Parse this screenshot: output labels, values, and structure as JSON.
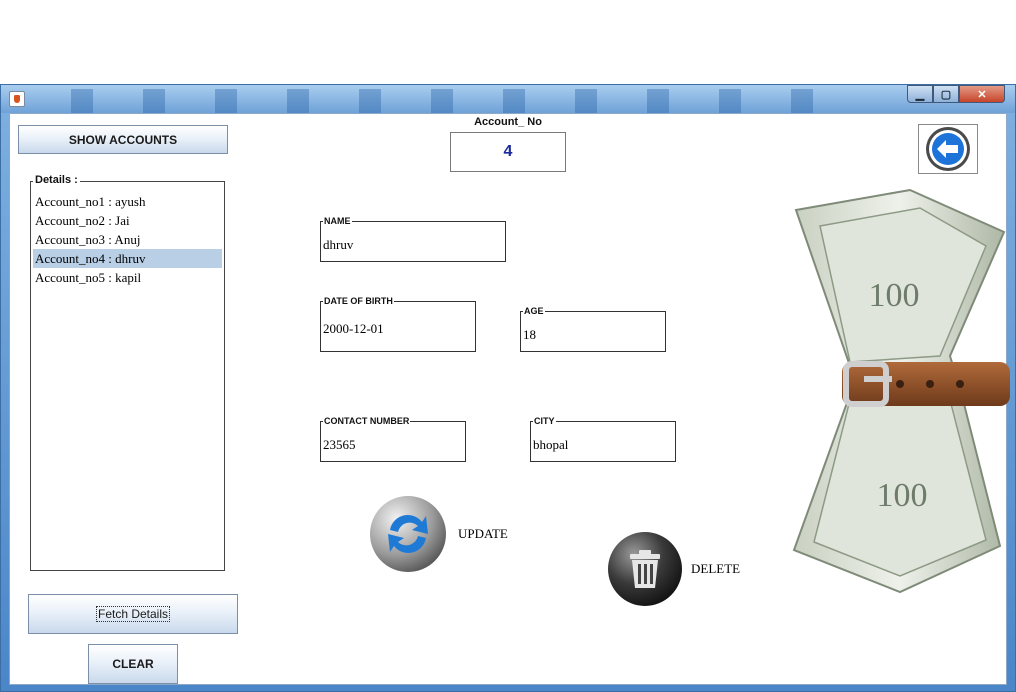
{
  "window": {
    "controls": {
      "minimize_icon": "minimize-icon",
      "maximize_icon": "maximize-icon",
      "close_icon": "close-icon"
    }
  },
  "sidebar": {
    "show_accounts_label": "SHOW ACCOUNTS",
    "details_title": "Details :",
    "accounts": [
      {
        "label": "Account_no1 : ayush",
        "selected": false
      },
      {
        "label": "Account_no2 : Jai",
        "selected": false
      },
      {
        "label": "Account_no3 : Anuj",
        "selected": false
      },
      {
        "label": "Account_no4 : dhruv",
        "selected": true
      },
      {
        "label": "Account_no5 : kapil",
        "selected": false
      }
    ],
    "fetch_details_label": "Fetch Details",
    "clear_label": "CLEAR"
  },
  "account": {
    "label": "Account_ No",
    "value": "4"
  },
  "form": {
    "name": {
      "title": "NAME",
      "value": "dhruv"
    },
    "dob": {
      "title": "DATE OF BIRTH",
      "value": "2000-12-01"
    },
    "age": {
      "title": "AGE",
      "value": "18"
    },
    "contact": {
      "title": "CONTACT NUMBER",
      "value": "23565"
    },
    "city": {
      "title": "CITY",
      "value": "bhopal"
    }
  },
  "actions": {
    "update_label": "UPDATE",
    "delete_label": "DELETE"
  },
  "colors": {
    "selection": "#b8cfe5",
    "account_value": "#1a2a9c",
    "back_icon": "#1e73d8"
  }
}
